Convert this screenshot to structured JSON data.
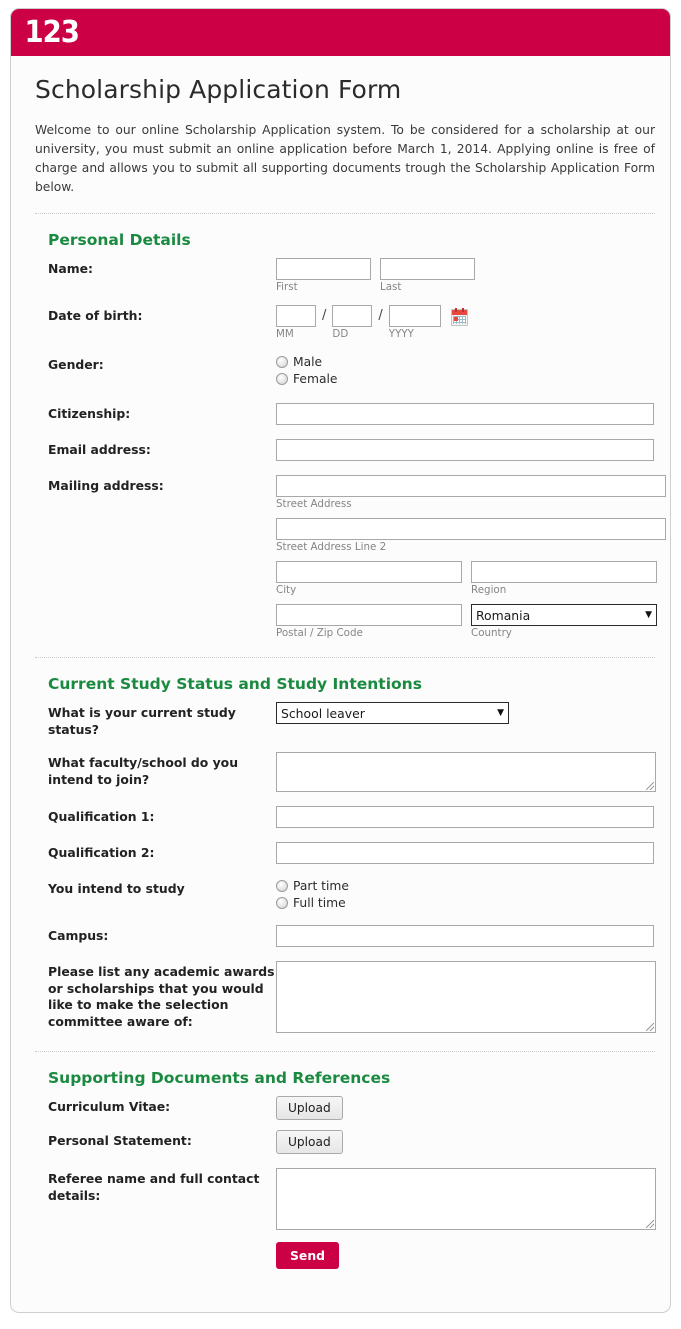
{
  "brand": {
    "logo_text": "123",
    "header_color": "#cc0044",
    "section_heading_color": "#1a8a40"
  },
  "form": {
    "title": "Scholarship Application Form",
    "intro": "Welcome to our online Scholarship Application system. To be considered for a scholarship at our university, you must submit an online application before March 1, 2014. Applying online is free of charge and allows you to submit all supporting documents trough the Scholarship Application Form below."
  },
  "personal": {
    "heading": "Personal Details",
    "name_label": "Name:",
    "name_first_value": "",
    "name_first_sub": "First",
    "name_last_value": "",
    "name_last_sub": "Last",
    "dob_label": "Date of birth:",
    "dob_mm_value": "",
    "dob_mm_sub": "MM",
    "dob_dd_value": "",
    "dob_dd_sub": "DD",
    "dob_yyyy_value": "",
    "dob_yyyy_sub": "YYYY",
    "dob_slash": "/",
    "gender_label": "Gender:",
    "gender_options": [
      "Male",
      "Female"
    ],
    "citizenship_label": "Citizenship:",
    "citizenship_value": "",
    "email_label": "Email address:",
    "email_value": "",
    "mailing_label": "Mailing address:",
    "street1_value": "",
    "street1_sub": "Street Address",
    "street2_value": "",
    "street2_sub": "Street Address Line 2",
    "city_value": "",
    "city_sub": "City",
    "region_value": "",
    "region_sub": "Region",
    "postal_value": "",
    "postal_sub": "Postal / Zip Code",
    "country_value": "Romania",
    "country_sub": "Country"
  },
  "study": {
    "heading": "Current Study Status and Study Intentions",
    "status_label": "What is your current study status?",
    "status_value": "School leaver",
    "faculty_label": "What faculty/school do you intend to join?",
    "faculty_value": "",
    "qual1_label": "Qualification 1:",
    "qual1_value": "",
    "qual2_label": "Qualification 2:",
    "qual2_value": "",
    "intend_label": "You intend to study",
    "intend_options": [
      "Part time",
      "Full time"
    ],
    "campus_label": "Campus:",
    "campus_value": "",
    "awards_label": "Please list any academic awards or scholarships that you would like to make the selection committee aware of:",
    "awards_value": ""
  },
  "documents": {
    "heading": "Supporting Documents and References",
    "cv_label": "Curriculum Vitae:",
    "cv_button": "Upload",
    "statement_label": "Personal Statement:",
    "statement_button": "Upload",
    "referee_label": "Referee name and full contact details:",
    "referee_value": "",
    "send_button": "Send"
  },
  "icons": {
    "calendar": "calendar-icon",
    "dropdown_arrow": "▼"
  }
}
